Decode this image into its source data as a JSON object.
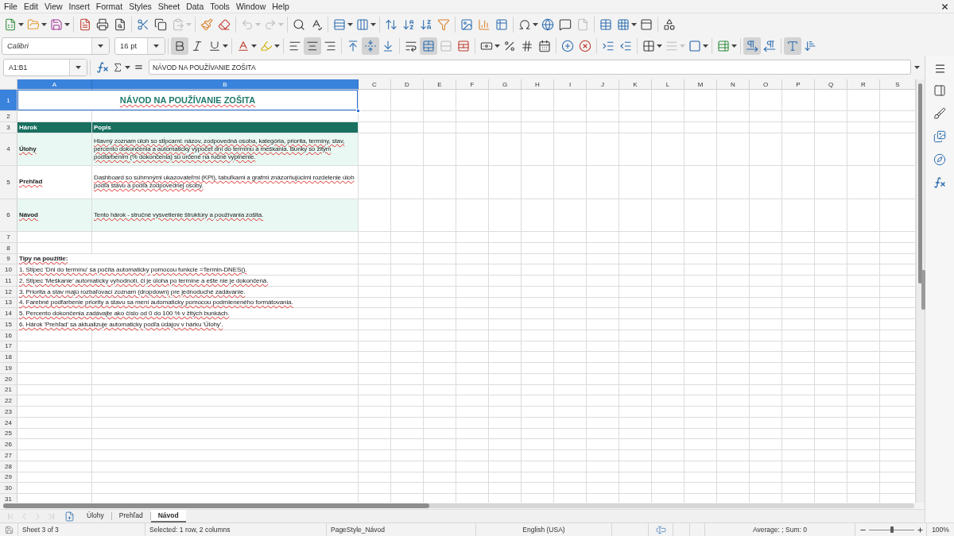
{
  "menu": [
    "File",
    "Edit",
    "View",
    "Insert",
    "Format",
    "Styles",
    "Sheet",
    "Data",
    "Tools",
    "Window",
    "Help"
  ],
  "standard_toolbar": {
    "groups": [
      [
        {
          "kind": "new",
          "dropdown": true,
          "pressed": false,
          "disabled": false
        },
        {
          "kind": "open",
          "dropdown": true,
          "pressed": false,
          "disabled": false
        },
        {
          "kind": "save",
          "dropdown": true,
          "pressed": false,
          "disabled": false
        }
      ],
      [
        {
          "kind": "pdf",
          "dropdown": false,
          "pressed": false,
          "disabled": false
        },
        {
          "kind": "print",
          "dropdown": false,
          "pressed": false,
          "disabled": false
        },
        {
          "kind": "preview",
          "dropdown": false,
          "pressed": false,
          "disabled": false
        }
      ],
      [
        {
          "kind": "cut",
          "dropdown": false,
          "pressed": false,
          "disabled": false
        },
        {
          "kind": "copy",
          "dropdown": false,
          "pressed": false,
          "disabled": false
        },
        {
          "kind": "paste",
          "dropdown": true,
          "pressed": false,
          "disabled": true
        }
      ],
      [
        {
          "kind": "clone",
          "dropdown": false,
          "pressed": false,
          "disabled": false
        },
        {
          "kind": "clear",
          "dropdown": false,
          "pressed": false,
          "disabled": false
        }
      ],
      [
        {
          "kind": "undo",
          "dropdown": true,
          "pressed": false,
          "disabled": true
        },
        {
          "kind": "redo",
          "dropdown": true,
          "pressed": false,
          "disabled": true
        }
      ],
      [
        {
          "kind": "find",
          "dropdown": false,
          "pressed": false,
          "disabled": false
        },
        {
          "kind": "spelling",
          "dropdown": false,
          "pressed": false,
          "disabled": false
        }
      ],
      [
        {
          "kind": "row",
          "dropdown": true,
          "pressed": false,
          "disabled": false
        },
        {
          "kind": "column",
          "dropdown": true,
          "pressed": false,
          "disabled": false
        }
      ],
      [
        {
          "kind": "sort",
          "dropdown": false,
          "pressed": false,
          "disabled": false
        },
        {
          "kind": "sortasc",
          "dropdown": false,
          "pressed": false,
          "disabled": false
        },
        {
          "kind": "sortdesc",
          "dropdown": false,
          "pressed": false,
          "disabled": false
        },
        {
          "kind": "autofilter",
          "dropdown": false,
          "pressed": false,
          "disabled": false
        }
      ],
      [
        {
          "kind": "image",
          "dropdown": false,
          "pressed": false,
          "disabled": false
        },
        {
          "kind": "chart",
          "dropdown": false,
          "pressed": false,
          "disabled": false
        },
        {
          "kind": "pivot",
          "dropdown": false,
          "pressed": false,
          "disabled": false
        }
      ],
      [
        {
          "kind": "special",
          "dropdown": true,
          "pressed": false,
          "disabled": false
        },
        {
          "kind": "hyperlink",
          "dropdown": false,
          "pressed": false,
          "disabled": false
        },
        {
          "kind": "comment",
          "dropdown": false,
          "pressed": false,
          "disabled": false
        },
        {
          "kind": "headerfooter",
          "dropdown": false,
          "pressed": false,
          "disabled": true
        }
      ],
      [
        {
          "kind": "printarea",
          "dropdown": false,
          "pressed": false,
          "disabled": false
        },
        {
          "kind": "freeze",
          "dropdown": true,
          "pressed": false,
          "disabled": false
        },
        {
          "kind": "split",
          "dropdown": false,
          "pressed": false,
          "disabled": false
        }
      ],
      [
        {
          "kind": "draw",
          "dropdown": false,
          "pressed": false,
          "disabled": false
        }
      ]
    ]
  },
  "formatting_toolbar": {
    "font_name": "Calibri",
    "font_size": "16 pt",
    "groups": [
      [
        {
          "kind": "bold",
          "dropdown": false,
          "pressed": true,
          "disabled": false
        },
        {
          "kind": "italic",
          "dropdown": false,
          "pressed": false,
          "disabled": false
        },
        {
          "kind": "underline",
          "dropdown": true,
          "pressed": false,
          "disabled": false
        }
      ],
      [
        {
          "kind": "fontcolor",
          "dropdown": true,
          "pressed": false,
          "disabled": false
        },
        {
          "kind": "highlight",
          "dropdown": true,
          "pressed": false,
          "disabled": false
        }
      ],
      [
        {
          "kind": "alignleft",
          "dropdown": false,
          "pressed": false,
          "disabled": false
        },
        {
          "kind": "aligncenter",
          "dropdown": false,
          "pressed": true,
          "disabled": false
        },
        {
          "kind": "alignright",
          "dropdown": false,
          "pressed": false,
          "disabled": false
        }
      ],
      [
        {
          "kind": "aligntop",
          "dropdown": false,
          "pressed": false,
          "disabled": false
        },
        {
          "kind": "alignmiddle",
          "dropdown": false,
          "pressed": true,
          "disabled": false
        },
        {
          "kind": "alignbottom",
          "dropdown": false,
          "pressed": false,
          "disabled": false
        }
      ],
      [
        {
          "kind": "wrap",
          "dropdown": false,
          "pressed": false,
          "disabled": false
        },
        {
          "kind": "mergecenter",
          "dropdown": false,
          "pressed": true,
          "disabled": false
        },
        {
          "kind": "merge",
          "dropdown": false,
          "pressed": false,
          "disabled": true
        },
        {
          "kind": "unmerge",
          "dropdown": false,
          "pressed": false,
          "disabled": false
        }
      ],
      [
        {
          "kind": "currency",
          "dropdown": true,
          "pressed": false,
          "disabled": false
        },
        {
          "kind": "percent",
          "dropdown": false,
          "pressed": false,
          "disabled": false
        },
        {
          "kind": "number",
          "dropdown": false,
          "pressed": false,
          "disabled": false
        },
        {
          "kind": "date",
          "dropdown": false,
          "pressed": false,
          "disabled": false
        }
      ],
      [
        {
          "kind": "adddecimal",
          "dropdown": false,
          "pressed": false,
          "disabled": false
        },
        {
          "kind": "deldecimal",
          "dropdown": false,
          "pressed": false,
          "disabled": false
        }
      ],
      [
        {
          "kind": "indentinc",
          "dropdown": false,
          "pressed": false,
          "disabled": false
        },
        {
          "kind": "indentdec",
          "dropdown": false,
          "pressed": false,
          "disabled": false
        }
      ],
      [
        {
          "kind": "borders",
          "dropdown": true,
          "pressed": false,
          "disabled": false
        },
        {
          "kind": "borderstyle",
          "dropdown": true,
          "pressed": false,
          "disabled": true
        },
        {
          "kind": "bordercolor",
          "dropdown": true,
          "pressed": false,
          "disabled": false
        }
      ],
      [
        {
          "kind": "conditional",
          "dropdown": true,
          "pressed": false,
          "disabled": false
        }
      ],
      [
        {
          "kind": "ltr",
          "dropdown": false,
          "pressed": true,
          "disabled": false
        },
        {
          "kind": "rtl",
          "dropdown": false,
          "pressed": false,
          "disabled": false
        }
      ],
      [
        {
          "kind": "textltr",
          "dropdown": false,
          "pressed": true,
          "disabled": false
        },
        {
          "kind": "texttb",
          "dropdown": false,
          "pressed": false,
          "disabled": false
        }
      ]
    ]
  },
  "formula_bar": {
    "name_box": "A1:B1",
    "value": "NÁVOD NA POUŽÍVANIE ZOŠITA"
  },
  "sheet": {
    "autospell": true,
    "columns": [
      {
        "label": "A",
        "selected": true
      },
      {
        "label": "B",
        "selected": true
      },
      {
        "label": "C",
        "selected": false
      },
      {
        "label": "D",
        "selected": false
      },
      {
        "label": "E",
        "selected": false
      },
      {
        "label": "F",
        "selected": false
      },
      {
        "label": "G",
        "selected": false
      },
      {
        "label": "H",
        "selected": false
      },
      {
        "label": "I",
        "selected": false
      },
      {
        "label": "J",
        "selected": false
      },
      {
        "label": "K",
        "selected": false
      },
      {
        "label": "L",
        "selected": false
      },
      {
        "label": "M",
        "selected": false
      },
      {
        "label": "N",
        "selected": false
      },
      {
        "label": "O",
        "selected": false
      },
      {
        "label": "P",
        "selected": false
      },
      {
        "label": "Q",
        "selected": false
      },
      {
        "label": "R",
        "selected": false
      },
      {
        "label": "S",
        "selected": false
      }
    ],
    "rows": [
      {
        "label": "1",
        "selected": true,
        "kind": "title",
        "cells": [
          "NÁVOD NA POUŽÍVANIE ZOŠITA"
        ]
      },
      {
        "label": "2",
        "selected": false,
        "kind": "blank"
      },
      {
        "label": "3",
        "selected": false,
        "kind": "header",
        "cells": [
          "Hárok",
          "Popis"
        ]
      },
      {
        "label": "4",
        "selected": false,
        "kind": "entry",
        "shaded": true,
        "cells": [
          "Úlohy",
          "Hlavný zoznam úloh so stĺpcami: názov, zodpovedná osoba, kategória, priorita, termíny, stav, percento dokončenia a automatický výpočet dní do termínu a meškania. Bunky so žltým podfarbením (% dokončenia) sú určené na ručné vyplnenie."
        ]
      },
      {
        "label": "5",
        "selected": false,
        "kind": "entry",
        "shaded": false,
        "cells": [
          "Prehľad",
          "Dashboard so súhrnnými ukazovateľmi (KPI), tabuľkami a grafmi znázorňujúcimi rozdelenie úloh podľa stavu a podľa zodpovednej osoby."
        ]
      },
      {
        "label": "6",
        "selected": false,
        "kind": "entry",
        "shaded": true,
        "cells": [
          "Návod",
          "Tento hárok - stručné vysvetlenie štruktúry a používania zošita."
        ]
      },
      {
        "label": "7",
        "selected": false,
        "kind": "blank"
      },
      {
        "label": "8",
        "selected": false,
        "kind": "blank"
      },
      {
        "label": "9",
        "selected": false,
        "kind": "subhead",
        "cells": [
          "Tipy na použitie:"
        ]
      },
      {
        "label": "10",
        "selected": false,
        "kind": "tip",
        "cells": [
          "1. Stĺpec 'Dni do termínu' sa počíta automaticky pomocou funkcie =Termin-DNES()."
        ]
      },
      {
        "label": "11",
        "selected": false,
        "kind": "tip",
        "cells": [
          "2. Stĺpec 'Meškanie' automaticky vyhodnotí, či je úloha po termíne a ešte nie je dokončená."
        ]
      },
      {
        "label": "12",
        "selected": false,
        "kind": "tip",
        "cells": [
          "3. Priorita a stav majú rozbaľovací zoznam (dropdown) pre jednoduché zadávanie."
        ]
      },
      {
        "label": "13",
        "selected": false,
        "kind": "tip",
        "cells": [
          "4. Farebné podfarbenie priority a stavu sa mení automaticky pomocou podmieneného formátovania."
        ]
      },
      {
        "label": "14",
        "selected": false,
        "kind": "tip",
        "cells": [
          "5. Percento dokončenia zadávajte ako číslo od 0 do 100 % v žltých bunkách."
        ]
      },
      {
        "label": "15",
        "selected": false,
        "kind": "tip",
        "cells": [
          "6. Hárok 'Prehľad' sa aktualizuje automaticky podľa údajov v hárku 'Úlohy'."
        ]
      },
      {
        "label": "16",
        "selected": false,
        "kind": "blank"
      },
      {
        "label": "17",
        "selected": false,
        "kind": "blank"
      },
      {
        "label": "18",
        "selected": false,
        "kind": "blank"
      },
      {
        "label": "19",
        "selected": false,
        "kind": "blank"
      },
      {
        "label": "20",
        "selected": false,
        "kind": "blank"
      },
      {
        "label": "21",
        "selected": false,
        "kind": "blank"
      },
      {
        "label": "22",
        "selected": false,
        "kind": "blank"
      },
      {
        "label": "23",
        "selected": false,
        "kind": "blank"
      },
      {
        "label": "24",
        "selected": false,
        "kind": "blank"
      },
      {
        "label": "25",
        "selected": false,
        "kind": "blank"
      },
      {
        "label": "26",
        "selected": false,
        "kind": "blank"
      },
      {
        "label": "27",
        "selected": false,
        "kind": "blank"
      },
      {
        "label": "28",
        "selected": false,
        "kind": "blank"
      },
      {
        "label": "29",
        "selected": false,
        "kind": "blank"
      },
      {
        "label": "30",
        "selected": false,
        "kind": "blank"
      },
      {
        "label": "31",
        "selected": false,
        "kind": "blank"
      }
    ]
  },
  "sheet_tabs": {
    "nav": [
      {
        "kind": "first",
        "disabled": true
      },
      {
        "kind": "previous",
        "disabled": true
      },
      {
        "kind": "next",
        "disabled": true
      },
      {
        "kind": "last",
        "disabled": true
      }
    ],
    "tabs": [
      {
        "label": "Úlohy",
        "selected": false
      },
      {
        "label": "Prehľad",
        "selected": false
      },
      {
        "label": "Návod",
        "selected": true
      }
    ]
  },
  "status_bar": {
    "sheet": "Sheet 3 of 3",
    "selection": "Selected: 1 row, 2 columns",
    "page_style": "PageStyle_Návod",
    "language": "English (USA)",
    "summary": "Average: ; Sum: 0",
    "zoom": {
      "level": 0.5,
      "reading": "100%"
    }
  }
}
